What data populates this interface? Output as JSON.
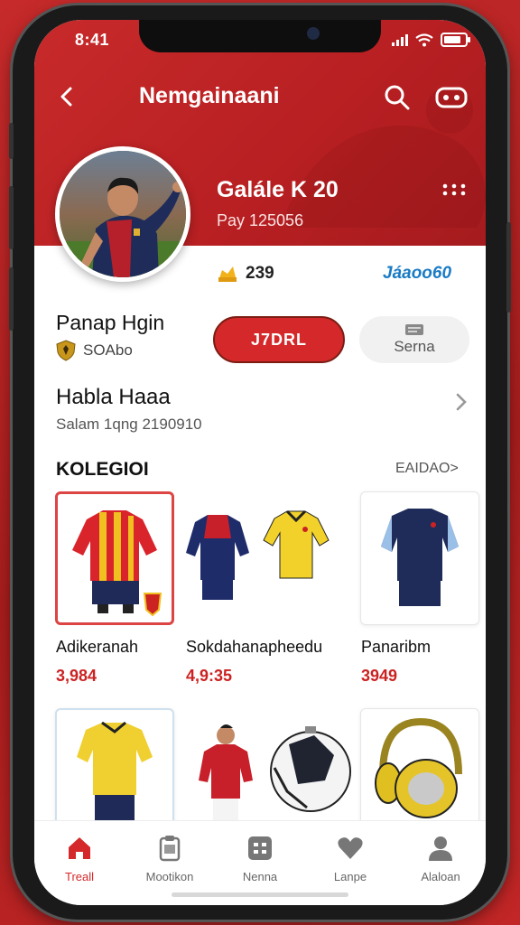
{
  "status": {
    "time": "8:41"
  },
  "nav": {
    "title": "Nemgainaani"
  },
  "profile": {
    "name": "Galále K 20",
    "subtitle": "Pay 125056",
    "coins": "239",
    "brand_link": "Jáaoo60"
  },
  "follow": {
    "name": "Panap Hgin",
    "sub": "SOAbo",
    "primary_label": "J7DRL",
    "secondary_label": "Serna"
  },
  "section": {
    "title": "Habla Haaa",
    "subtitle": "Salam 1qng 2190910"
  },
  "collection": {
    "title": "KOLEGIOI",
    "see_all": "EAIDAO>",
    "items": [
      {
        "name": "Adikeranah",
        "price": "3,984"
      },
      {
        "name": "Sokdahanapheedu",
        "price": "4,9:35"
      },
      {
        "name": "Panaribm",
        "price": "3949"
      }
    ]
  },
  "tabs": [
    {
      "label": "Treall",
      "icon": "home-icon",
      "active": true
    },
    {
      "label": "Mootikon",
      "icon": "clipboard-icon",
      "active": false
    },
    {
      "label": "Nenna",
      "icon": "grid-icon",
      "active": false
    },
    {
      "label": "Lanpe",
      "icon": "heart-icon",
      "active": false
    },
    {
      "label": "Alaloan",
      "icon": "profile-icon",
      "active": false
    }
  ],
  "colors": {
    "accent": "#d4282a",
    "link": "#1a7bc4",
    "hero": "#c82a2a"
  }
}
